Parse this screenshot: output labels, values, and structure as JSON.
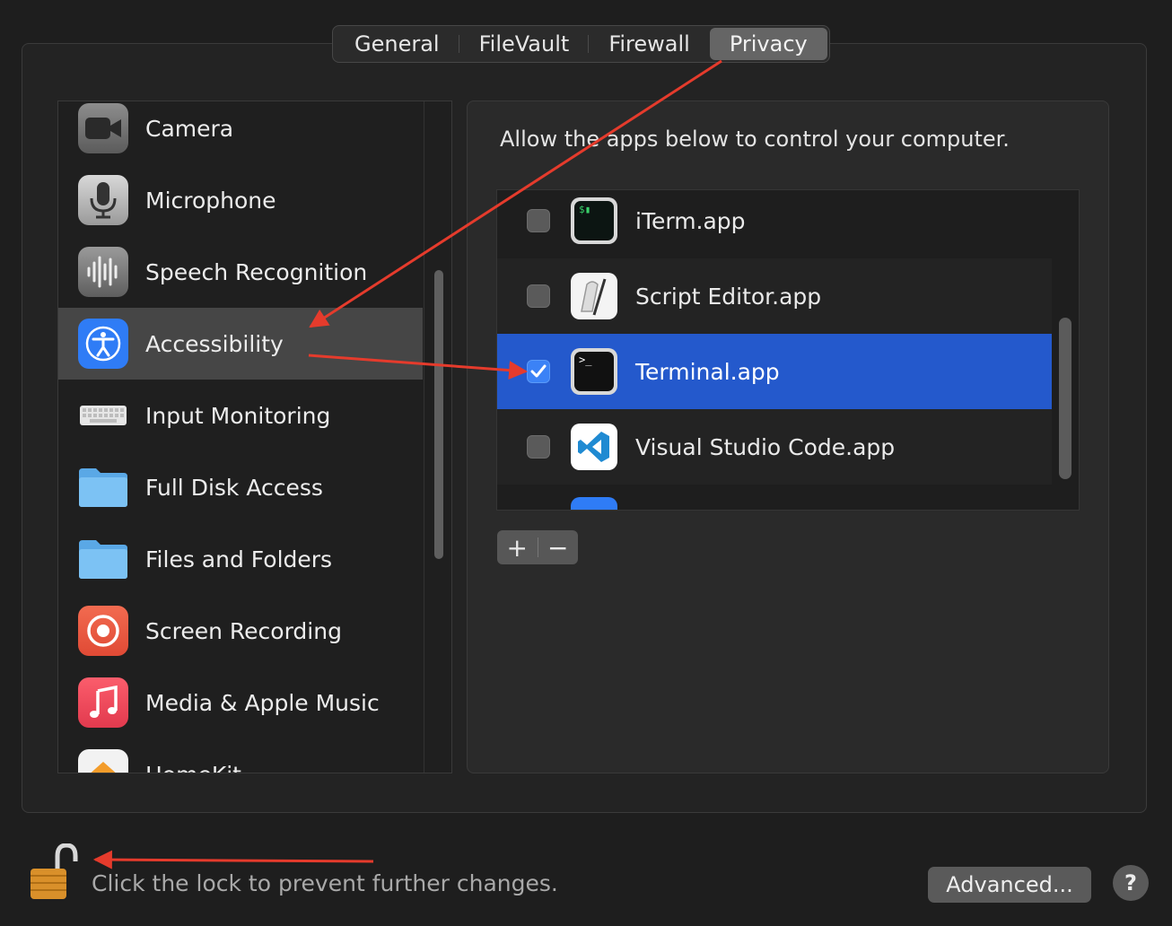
{
  "tabs": [
    {
      "label": "General"
    },
    {
      "label": "FileVault"
    },
    {
      "label": "Firewall"
    },
    {
      "label": "Privacy"
    }
  ],
  "sidebar": {
    "items": [
      {
        "label": "Camera",
        "icon": "camera-icon"
      },
      {
        "label": "Microphone",
        "icon": "microphone-icon"
      },
      {
        "label": "Speech Recognition",
        "icon": "speech-recognition-icon"
      },
      {
        "label": "Accessibility",
        "icon": "accessibility-icon",
        "selected": true
      },
      {
        "label": "Input Monitoring",
        "icon": "keyboard-icon"
      },
      {
        "label": "Full Disk Access",
        "icon": "folder-icon"
      },
      {
        "label": "Files and Folders",
        "icon": "folder-icon"
      },
      {
        "label": "Screen Recording",
        "icon": "screen-recording-icon"
      },
      {
        "label": "Media & Apple Music",
        "icon": "music-icon"
      },
      {
        "label": "HomeKit",
        "icon": "home-icon"
      }
    ]
  },
  "main": {
    "description": "Allow the apps below to control your computer.",
    "apps": [
      {
        "label": "iTerm.app",
        "checked": false,
        "icon": "iterm-icon"
      },
      {
        "label": "Script Editor.app",
        "checked": false,
        "icon": "script-editor-icon"
      },
      {
        "label": "Terminal.app",
        "checked": true,
        "selected": true,
        "icon": "terminal-icon"
      },
      {
        "label": "Visual Studio Code.app",
        "checked": false,
        "icon": "vscode-icon"
      }
    ],
    "add_label": "+",
    "remove_label": "−"
  },
  "footer": {
    "lock_text": "Click the lock to prevent further changes.",
    "advanced_label": "Advanced...",
    "help_label": "?"
  },
  "colors": {
    "selection_blue": "#2459cc",
    "annotation_red": "#e53b2c",
    "accessibility_blue": "#2f7cf6"
  }
}
